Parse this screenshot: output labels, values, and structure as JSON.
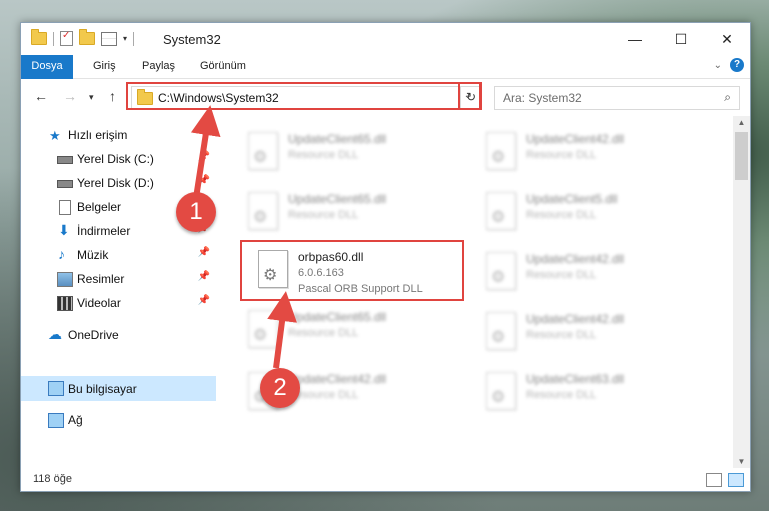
{
  "window": {
    "title": "System32",
    "controls": {
      "minimize": "—",
      "maximize": "☐",
      "close": "✕"
    }
  },
  "ribbon": {
    "tabs": [
      "Dosya",
      "Giriş",
      "Paylaş",
      "Görünüm"
    ]
  },
  "address": {
    "path": "C:\\Windows\\System32",
    "search_placeholder": "Ara: System32"
  },
  "navpane": {
    "quick_access": "Hızlı erişim",
    "items": [
      {
        "label": "Yerel Disk (C:)",
        "icon": "drive-icon"
      },
      {
        "label": "Yerel Disk (D:)",
        "icon": "drive-icon"
      },
      {
        "label": "Belgeler",
        "icon": "documents-icon"
      },
      {
        "label": "İndirmeler",
        "icon": "downloads-icon"
      },
      {
        "label": "Müzik",
        "icon": "music-icon"
      },
      {
        "label": "Resimler",
        "icon": "pictures-icon"
      },
      {
        "label": "Videolar",
        "icon": "videos-icon"
      }
    ],
    "onedrive": "OneDrive",
    "this_pc": "Bu bilgisayar",
    "network": "Ağ"
  },
  "files": {
    "left": [
      {
        "name": "UpdateClient65.dll",
        "desc": "Resource DLL"
      },
      {
        "name": "UpdateClient65.dll",
        "desc": "Resource DLL"
      },
      {
        "name": "UpdateClient65.dll",
        "desc": "Resource DLL"
      },
      {
        "name": "UpdateClient42.dll",
        "desc": "Resource DLL"
      }
    ],
    "right": [
      {
        "name": "UpdateClient42.dll",
        "desc": "Resource DLL"
      },
      {
        "name": "UpdateClient5.dll",
        "desc": "Resource DLL"
      },
      {
        "name": "UpdateClient42.dll",
        "desc": "Resource DLL"
      },
      {
        "name": "UpdateClient42.dll",
        "desc": "Resource DLL"
      },
      {
        "name": "UpdateClient63.dll",
        "desc": "Resource DLL"
      }
    ],
    "target": {
      "name": "orbpas60.dll",
      "version": "6.0.6.163",
      "desc": "Pascal ORB Support DLL"
    }
  },
  "status": {
    "count": "118 öğe"
  },
  "annotations": {
    "step1": "1",
    "step2": "2"
  },
  "colors": {
    "accent": "#1979ca",
    "highlight": "#e0443f",
    "selection": "#cce8ff"
  }
}
